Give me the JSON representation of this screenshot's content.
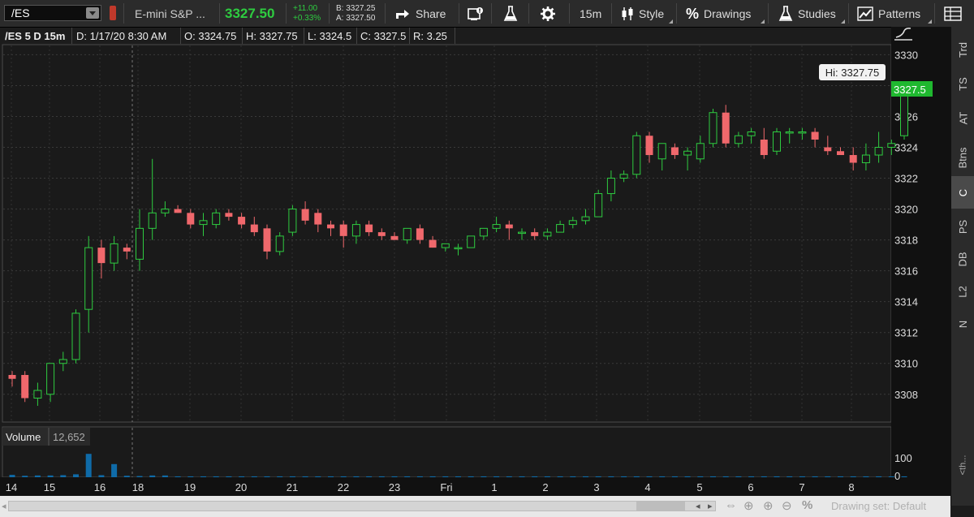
{
  "toolbar": {
    "symbol": "/ES",
    "description": "E-mini S&P ...",
    "last": "3327.50",
    "change": "+11.00",
    "change_pct": "+0.33%",
    "bid": "B: 3327.25",
    "ask": "A: 3327.50",
    "share_label": "Share",
    "timeframe_label": "15m",
    "style_label": "Style",
    "drawings_label": "Drawings",
    "studies_label": "Studies",
    "patterns_label": "Patterns"
  },
  "legend": {
    "symbol_period": "/ES 5 D 15m",
    "date": "D: 1/17/20 8:30 AM",
    "open": "O: 3324.75",
    "high": "H: 3327.75",
    "low": "L: 3324.5",
    "close": "C: 3327.5",
    "range": "R: 3.25"
  },
  "hi_label": "Hi: 3327.75",
  "price_badge": "3327.5",
  "volume": {
    "label": "Volume",
    "value": "12,652",
    "axis_labels": [
      "100",
      "0"
    ]
  },
  "side_tabs": [
    "Trd",
    "TS",
    "AT",
    "Btns",
    "C",
    "PS",
    "DB",
    "L2",
    "N"
  ],
  "side_tab_active": "C",
  "side_collapse_label": "<th...",
  "bottom": {
    "drawing_set": "Drawing set: Default"
  },
  "colors": {
    "up": "#2ecc40",
    "down": "#f0686c",
    "volume": "#0f6ba8",
    "price_badge": "#1fb82f"
  },
  "chart_data": {
    "type": "candlestick",
    "y_ticks": [
      3308,
      3310,
      3312,
      3314,
      3316,
      3318,
      3320,
      3322,
      3324,
      3326,
      3328,
      3330
    ],
    "y_tick_labels": [
      "3308",
      "3310",
      "3312",
      "3314",
      "3316",
      "3318",
      "3320",
      "3322",
      "3324",
      "3326",
      "3330"
    ],
    "ylim": [
      3306.2,
      3330.6
    ],
    "x_labels": [
      "14",
      "15",
      "16",
      "18",
      "19",
      "20",
      "21",
      "22",
      "23",
      "Fri",
      "1",
      "2",
      "3",
      "4",
      "5",
      "6",
      "7",
      "8"
    ],
    "session_break_label": "18",
    "candles": [
      {
        "o": 3309.25,
        "h": 3309.5,
        "l": 3308.5,
        "c": 3309.0
      },
      {
        "o": 3309.25,
        "h": 3309.5,
        "l": 3307.5,
        "c": 3307.75
      },
      {
        "o": 3307.75,
        "h": 3308.75,
        "l": 3307.25,
        "c": 3308.25
      },
      {
        "o": 3308.0,
        "h": 3310.0,
        "l": 3307.5,
        "c": 3310.0
      },
      {
        "o": 3310.0,
        "h": 3310.75,
        "l": 3309.5,
        "c": 3310.25
      },
      {
        "o": 3310.25,
        "h": 3313.5,
        "l": 3310.0,
        "c": 3313.25
      },
      {
        "o": 3313.5,
        "h": 3318.25,
        "l": 3312.0,
        "c": 3317.5
      },
      {
        "o": 3317.5,
        "h": 3318.0,
        "l": 3315.5,
        "c": 3316.5
      },
      {
        "o": 3316.5,
        "h": 3318.25,
        "l": 3316.0,
        "c": 3317.75
      },
      {
        "o": 3317.5,
        "h": 3317.75,
        "l": 3316.75,
        "c": 3317.25
      },
      {
        "o": 3316.75,
        "h": 3320.0,
        "l": 3316.0,
        "c": 3318.75
      },
      {
        "o": 3318.75,
        "h": 3323.25,
        "l": 3318.0,
        "c": 3319.75
      },
      {
        "o": 3319.75,
        "h": 3320.5,
        "l": 3319.5,
        "c": 3320.0
      },
      {
        "o": 3320.0,
        "h": 3320.25,
        "l": 3319.75,
        "c": 3319.75
      },
      {
        "o": 3319.75,
        "h": 3320.0,
        "l": 3318.75,
        "c": 3319.0
      },
      {
        "o": 3319.0,
        "h": 3319.75,
        "l": 3318.25,
        "c": 3319.25
      },
      {
        "o": 3319.0,
        "h": 3320.0,
        "l": 3318.75,
        "c": 3319.75
      },
      {
        "o": 3319.75,
        "h": 3320.0,
        "l": 3319.25,
        "c": 3319.5
      },
      {
        "o": 3319.5,
        "h": 3319.75,
        "l": 3318.75,
        "c": 3319.0
      },
      {
        "o": 3319.0,
        "h": 3319.5,
        "l": 3318.25,
        "c": 3318.5
      },
      {
        "o": 3318.75,
        "h": 3319.0,
        "l": 3316.75,
        "c": 3317.25
      },
      {
        "o": 3317.25,
        "h": 3318.5,
        "l": 3317.0,
        "c": 3318.25
      },
      {
        "o": 3318.5,
        "h": 3320.25,
        "l": 3318.25,
        "c": 3320.0
      },
      {
        "o": 3320.0,
        "h": 3320.5,
        "l": 3319.0,
        "c": 3319.25
      },
      {
        "o": 3319.75,
        "h": 3320.0,
        "l": 3318.5,
        "c": 3319.0
      },
      {
        "o": 3319.0,
        "h": 3319.25,
        "l": 3318.25,
        "c": 3318.75
      },
      {
        "o": 3319.0,
        "h": 3319.25,
        "l": 3317.5,
        "c": 3318.25
      },
      {
        "o": 3318.25,
        "h": 3319.25,
        "l": 3317.75,
        "c": 3319.0
      },
      {
        "o": 3319.0,
        "h": 3319.25,
        "l": 3318.25,
        "c": 3318.5
      },
      {
        "o": 3318.5,
        "h": 3318.75,
        "l": 3318.0,
        "c": 3318.25
      },
      {
        "o": 3318.25,
        "h": 3318.5,
        "l": 3318.0,
        "c": 3318.0
      },
      {
        "o": 3318.0,
        "h": 3318.75,
        "l": 3317.75,
        "c": 3318.75
      },
      {
        "o": 3318.75,
        "h": 3319.0,
        "l": 3317.75,
        "c": 3318.0
      },
      {
        "o": 3318.0,
        "h": 3318.25,
        "l": 3317.5,
        "c": 3317.5
      },
      {
        "o": 3317.5,
        "h": 3317.75,
        "l": 3317.25,
        "c": 3317.75
      },
      {
        "o": 3317.5,
        "h": 3317.75,
        "l": 3317.0,
        "c": 3317.5
      },
      {
        "o": 3317.5,
        "h": 3318.25,
        "l": 3317.5,
        "c": 3318.25
      },
      {
        "o": 3318.25,
        "h": 3318.75,
        "l": 3318.0,
        "c": 3318.75
      },
      {
        "o": 3318.75,
        "h": 3319.5,
        "l": 3318.5,
        "c": 3319.0
      },
      {
        "o": 3319.0,
        "h": 3319.25,
        "l": 3318.0,
        "c": 3318.75
      },
      {
        "o": 3318.5,
        "h": 3318.75,
        "l": 3318.0,
        "c": 3318.5
      },
      {
        "o": 3318.5,
        "h": 3318.75,
        "l": 3318.0,
        "c": 3318.25
      },
      {
        "o": 3318.25,
        "h": 3318.75,
        "l": 3318.0,
        "c": 3318.5
      },
      {
        "o": 3318.5,
        "h": 3319.25,
        "l": 3318.5,
        "c": 3319.0
      },
      {
        "o": 3319.0,
        "h": 3319.5,
        "l": 3318.75,
        "c": 3319.25
      },
      {
        "o": 3319.25,
        "h": 3320.0,
        "l": 3319.0,
        "c": 3319.5
      },
      {
        "o": 3319.5,
        "h": 3321.25,
        "l": 3319.5,
        "c": 3321.0
      },
      {
        "o": 3321.0,
        "h": 3322.5,
        "l": 3320.5,
        "c": 3322.0
      },
      {
        "o": 3322.0,
        "h": 3322.5,
        "l": 3321.75,
        "c": 3322.25
      },
      {
        "o": 3322.25,
        "h": 3325.0,
        "l": 3322.0,
        "c": 3324.75
      },
      {
        "o": 3324.75,
        "h": 3325.0,
        "l": 3323.0,
        "c": 3323.5
      },
      {
        "o": 3323.25,
        "h": 3324.25,
        "l": 3322.5,
        "c": 3324.25
      },
      {
        "o": 3324.0,
        "h": 3324.25,
        "l": 3323.25,
        "c": 3323.5
      },
      {
        "o": 3323.5,
        "h": 3324.0,
        "l": 3322.5,
        "c": 3323.75
      },
      {
        "o": 3323.25,
        "h": 3324.75,
        "l": 3323.0,
        "c": 3324.25
      },
      {
        "o": 3324.25,
        "h": 3326.5,
        "l": 3324.0,
        "c": 3326.25
      },
      {
        "o": 3326.25,
        "h": 3326.75,
        "l": 3324.0,
        "c": 3324.25
      },
      {
        "o": 3324.25,
        "h": 3325.0,
        "l": 3324.0,
        "c": 3324.75
      },
      {
        "o": 3324.75,
        "h": 3325.25,
        "l": 3324.25,
        "c": 3325.0
      },
      {
        "o": 3324.5,
        "h": 3325.25,
        "l": 3323.25,
        "c": 3323.5
      },
      {
        "o": 3323.75,
        "h": 3325.25,
        "l": 3323.5,
        "c": 3325.0
      },
      {
        "o": 3325.0,
        "h": 3325.25,
        "l": 3324.25,
        "c": 3325.0
      },
      {
        "o": 3325.0,
        "h": 3325.25,
        "l": 3324.5,
        "c": 3325.0
      },
      {
        "o": 3325.0,
        "h": 3325.25,
        "l": 3324.0,
        "c": 3324.5
      },
      {
        "o": 3324.0,
        "h": 3324.75,
        "l": 3323.5,
        "c": 3323.75
      },
      {
        "o": 3323.75,
        "h": 3324.0,
        "l": 3323.5,
        "c": 3323.5
      },
      {
        "o": 3323.5,
        "h": 3324.0,
        "l": 3322.5,
        "c": 3323.0
      },
      {
        "o": 3323.0,
        "h": 3324.25,
        "l": 3322.5,
        "c": 3323.5
      },
      {
        "o": 3323.5,
        "h": 3325.0,
        "l": 3323.0,
        "c": 3324.0
      },
      {
        "o": 3324.0,
        "h": 3324.5,
        "l": 3323.5,
        "c": 3324.25
      },
      {
        "o": 3324.75,
        "h": 3327.75,
        "l": 3324.5,
        "c": 3327.5
      }
    ],
    "volume": [
      8,
      5,
      6,
      6,
      7,
      10,
      80,
      7,
      45,
      5,
      4,
      6,
      6,
      3,
      3,
      3,
      3,
      3,
      3,
      3,
      3,
      3,
      3,
      3,
      3,
      3,
      3,
      3,
      3,
      3,
      3,
      3,
      3,
      3,
      3,
      3,
      3,
      3,
      3,
      3,
      3,
      3,
      3,
      3,
      3,
      3,
      3,
      3,
      3,
      3,
      3,
      3,
      3,
      3,
      3,
      3,
      3,
      3,
      3,
      3,
      3,
      3,
      3,
      3,
      3,
      3,
      3,
      3,
      3,
      3,
      3
    ],
    "volume_ylim": [
      0,
      100
    ]
  }
}
